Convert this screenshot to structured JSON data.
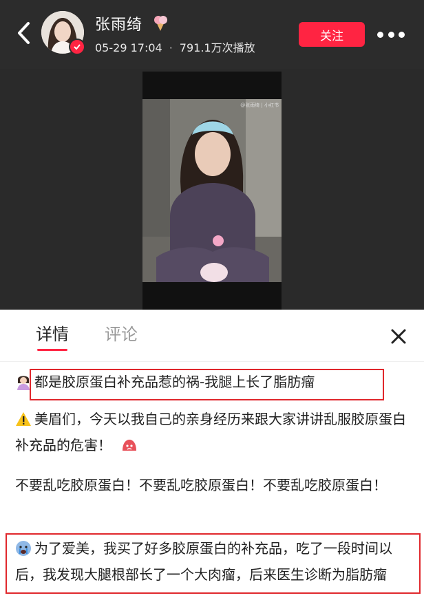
{
  "header": {
    "author_name": "张雨绮",
    "date": "05-29 17:04",
    "separator": "·",
    "plays": "791.1万次播放",
    "follow_label": "关注",
    "icons": {
      "back": "back-arrow-icon",
      "verified": "verified-badge-icon",
      "name_emoji": "ice-cream-emoji-icon",
      "more": "more-dots-icon"
    }
  },
  "video": {
    "watermark": "@张雨绮 | 小红书"
  },
  "tabs": [
    {
      "label": "详情",
      "active": true
    },
    {
      "label": "评论",
      "active": false
    }
  ],
  "content": {
    "line1": "都是胶原蛋白补充品惹的祸-我腿上长了脂肪瘤",
    "para2": "美眉们，今天以我自己的亲身经历来跟大家讲讲乱服胶原蛋白补充品的危害！",
    "para3": "不要乱吃胶原蛋白！不要乱吃胶原蛋白！不要乱吃胶原蛋白！",
    "para4": "为了爱美，我买了好多胶原蛋白的补充品，吃了一段时间以后，我发现大腿根部长了一个大肉瘤，后来医生诊断为脂肪瘤",
    "icons": {
      "line1": "person-gesturing-emoji-icon",
      "para2": "warning-emoji-icon",
      "para2_end": "pouting-emoji-icon",
      "para4": "crying-emoji-icon"
    }
  },
  "colors": {
    "accent": "#ff2442",
    "highlight_box": "#e0272c",
    "header_bg": "#2c2c2c"
  }
}
